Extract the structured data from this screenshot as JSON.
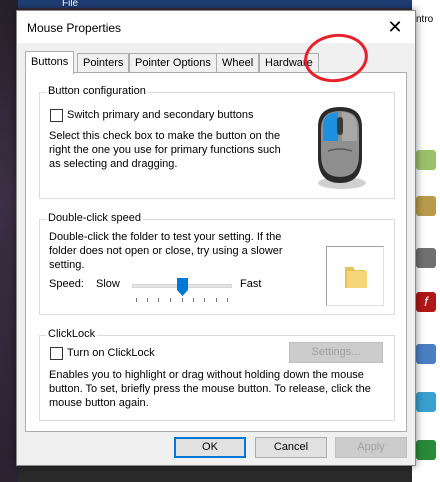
{
  "background": {
    "top_label": "File",
    "right_fragment": "ntro"
  },
  "window": {
    "title": "Mouse Properties",
    "close_symbol": "✕"
  },
  "tabs": [
    {
      "label": "Buttons",
      "active": true
    },
    {
      "label": "Pointers",
      "active": false
    },
    {
      "label": "Pointer Options",
      "active": false
    },
    {
      "label": "Wheel",
      "active": false
    },
    {
      "label": "Hardware",
      "active": false
    }
  ],
  "button_config": {
    "legend": "Button configuration",
    "checkbox_label": "Switch primary and secondary buttons",
    "checked": false,
    "description": "Select this check box to make the button on the right the one you use for primary functions such as selecting and dragging.",
    "icon": "mouse-icon"
  },
  "double_click": {
    "legend": "Double-click speed",
    "description": "Double-click the folder to test your setting. If the folder does not open or close, try using a slower setting.",
    "speed_label": "Speed:",
    "slow_label": "Slow",
    "fast_label": "Fast",
    "speed_fraction": 0.5,
    "icon": "folder-icon"
  },
  "clicklock": {
    "legend": "ClickLock",
    "checkbox_label": "Turn on ClickLock",
    "checked": false,
    "settings_label": "Settings...",
    "description": "Enables you to highlight or drag without holding down the mouse button. To set, briefly press the mouse button. To release, click the mouse button again."
  },
  "footer": {
    "ok_label": "OK",
    "cancel_label": "Cancel",
    "apply_label": "Apply"
  },
  "colors": {
    "accent": "#0078d7",
    "annotation": "#e8202a",
    "mouse_blue": "#1e90e0",
    "folder_yellow": "#f5d77a"
  }
}
